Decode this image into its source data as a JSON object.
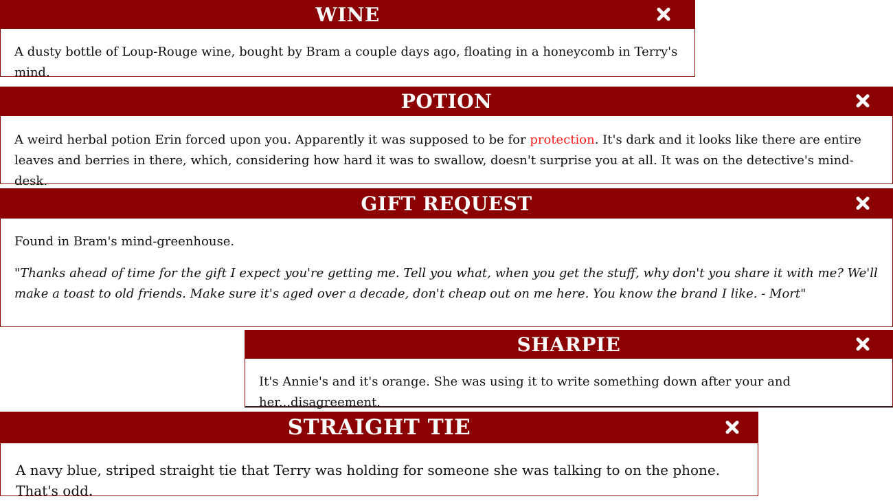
{
  "colors": {
    "header_background": "#8b0000",
    "header_text": "#ffffff",
    "body_background": "#ffffff",
    "body_text": "#111111",
    "highlight_text": "#ff1a1a"
  },
  "close_icon": "close-icon",
  "cards": {
    "wine": {
      "title": "WINE",
      "text": "A dusty bottle of Loup-Rouge wine, bought by Bram a couple days ago, floating in a honeycomb in Terry's mind."
    },
    "potion": {
      "title": "POTION",
      "text_before": "A weird herbal potion Erin forced upon you. Apparently it was supposed to be for ",
      "highlight": "protection",
      "text_after": ". It's dark and it looks like there are entire leaves and berries in there, which, considering how hard it was to swallow, doesn't surprise you at all. It was on the detective's mind-desk."
    },
    "gift": {
      "title": "GIFT REQUEST",
      "text": "Found in Bram's mind-greenhouse.",
      "quote": "\"Thanks ahead of time for the gift I expect you're getting me. Tell you what, when you get the stuff, why don't you share it with me? We'll make a toast to old friends. Make sure it's aged over a decade, don't cheap out on me here. You know the brand I like. - Mort\""
    },
    "sharpie": {
      "title": "SHARPIE",
      "text": "It's Annie's and it's orange. She was using it to write something down after your and her...disagreement."
    },
    "tie": {
      "title": "STRAIGHT TIE",
      "text": "A navy blue, striped straight tie that Terry was holding for someone she was talking to on the phone. That's odd."
    }
  }
}
